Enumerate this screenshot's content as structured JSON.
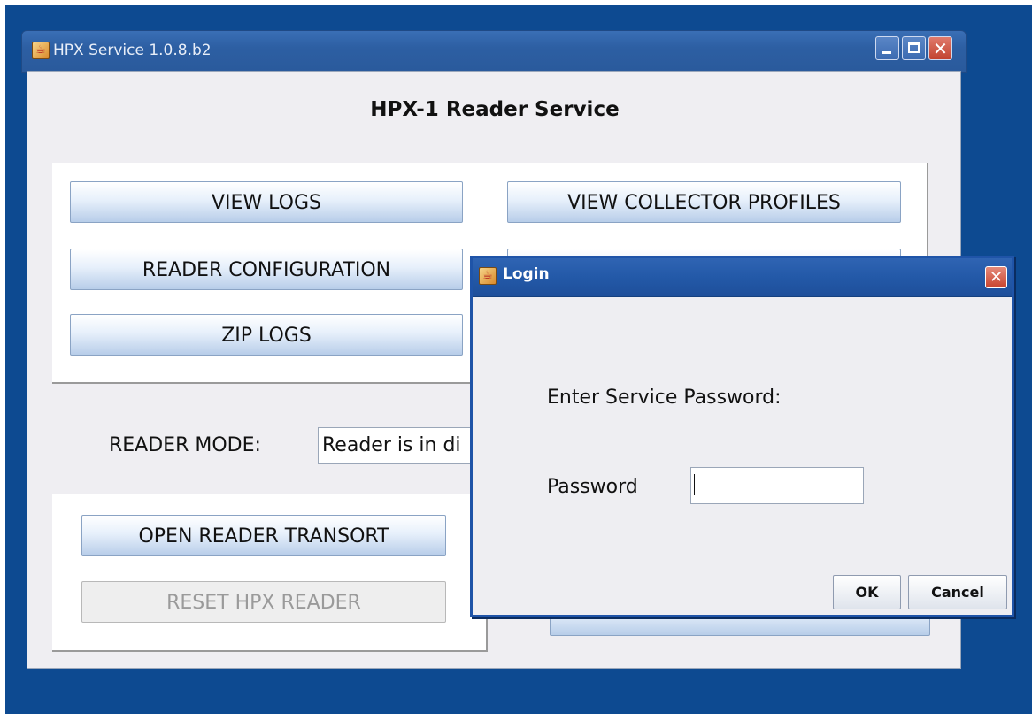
{
  "window": {
    "title": "HPX Service 1.0.8.b2",
    "heading": "HPX-1 Reader Service"
  },
  "buttons": {
    "view_logs": "VIEW LOGS",
    "view_collector_profiles": "VIEW COLLECTOR PROFILES",
    "reader_configuration": "READER CONFIGURATION",
    "zip_logs": "ZIP LOGS",
    "open_reader_transort": "OPEN READER TRANSORT",
    "reset_hpx_reader": "RESET HPX READER"
  },
  "reader_mode": {
    "label": "READER MODE:",
    "value": "Reader is in di"
  },
  "login_dialog": {
    "title": "Login",
    "prompt": "Enter Service Password:",
    "password_label": "Password",
    "password_value": "",
    "ok_label": "OK",
    "cancel_label": "Cancel"
  },
  "colors": {
    "desktop": "#0d4a91",
    "title_bar": "#2d5fa3",
    "button_gradient_bottom": "#b7cde9",
    "dialog_border": "#1f54a8"
  },
  "icons": {
    "app": "java-cup-icon",
    "minimize": "minimize-icon",
    "maximize": "maximize-icon",
    "close": "close-icon"
  }
}
